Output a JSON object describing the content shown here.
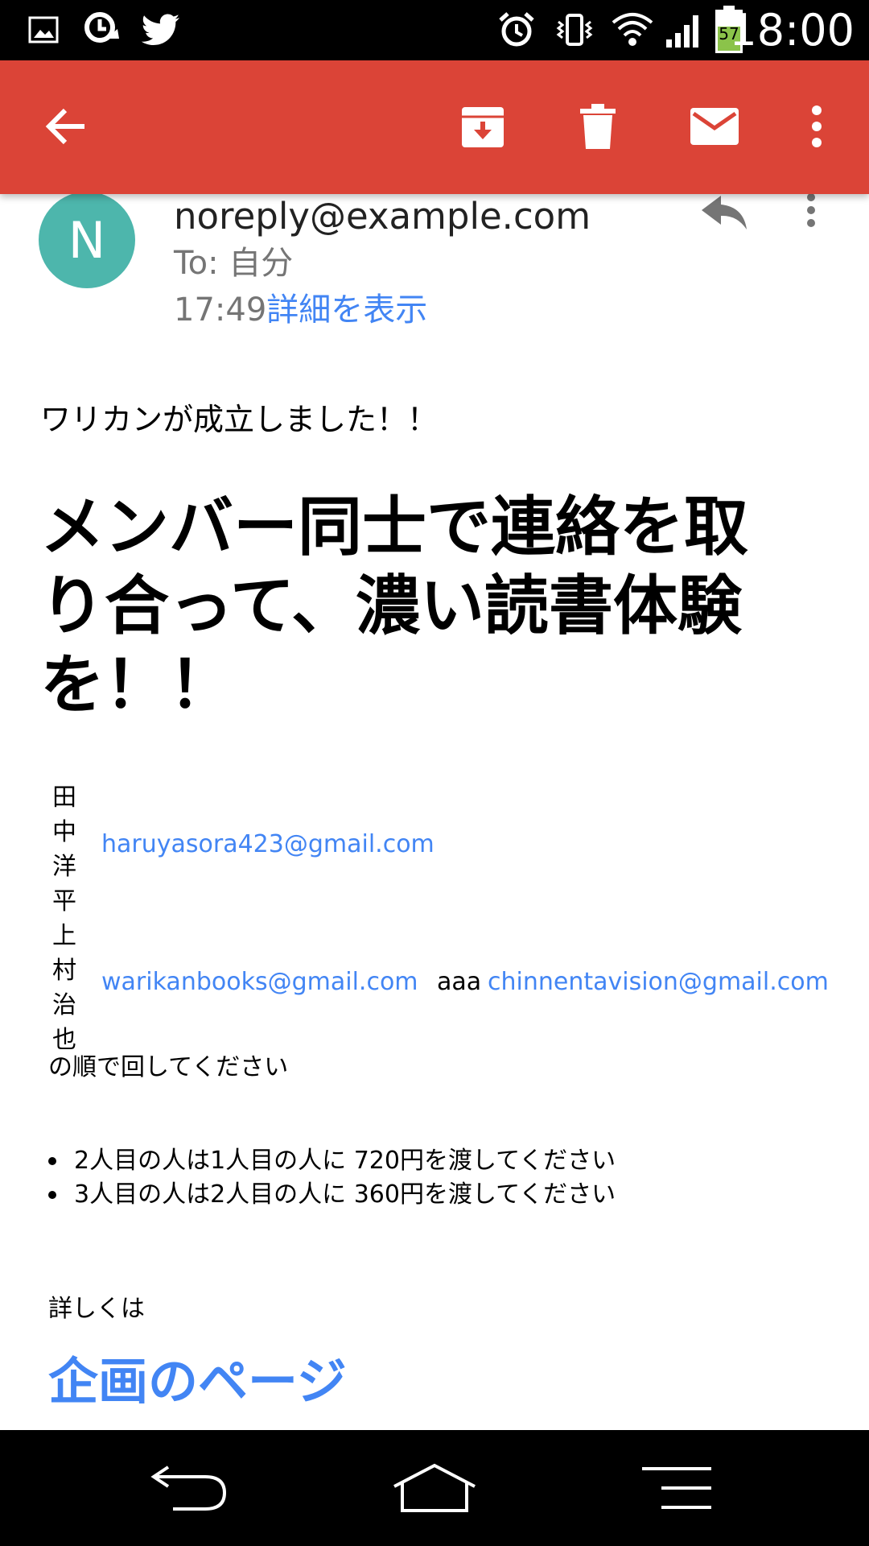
{
  "status_bar": {
    "time": "18:00",
    "battery_level": "57",
    "left_icons": [
      "image-icon",
      "sync-icon",
      "twitter-icon"
    ],
    "right_icons": [
      "alarm-icon",
      "vibrate-icon",
      "wifi-icon",
      "signal-icon",
      "battery-icon"
    ]
  },
  "app_bar": {
    "color": "#db4437",
    "actions": [
      "back-icon",
      "archive-icon",
      "delete-icon",
      "mark-unread-icon",
      "more-vert-icon"
    ]
  },
  "email": {
    "avatar_letter": "N",
    "avatar_color": "#4db6ac",
    "sender": "noreply@example.com",
    "to": "To: 自分",
    "time": "17:49",
    "details_link": "詳細を表示",
    "intro": "ワリカンが成立しました！！",
    "headline": "メンバー同士で連絡を取り合って、濃い読書体験を！！",
    "names_vertical": [
      "田",
      "中",
      "洋",
      "平",
      "上",
      "村",
      "治",
      "也"
    ],
    "emails": {
      "first": "haruyasora423@gmail.com",
      "second": "warikanbooks@gmail.com",
      "third": "chinnentavision@gmail.com"
    },
    "aaa": "aaa",
    "order_text": "の順で回してください",
    "bullets": [
      "2人目の人は1人目の人に 720円を渡してください",
      "3人目の人は2人目の人に 360円を渡してください"
    ],
    "more_text": "詳しくは",
    "project_link": "企画のページ",
    "link_color": "#4285f4"
  },
  "nav_bar": {
    "buttons": [
      "back-nav-icon",
      "home-icon",
      "recents-icon"
    ]
  }
}
